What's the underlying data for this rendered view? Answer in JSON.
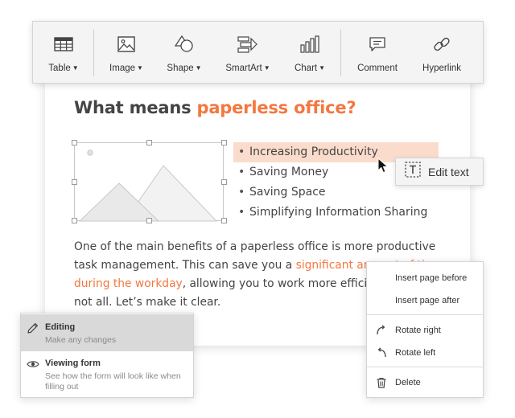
{
  "toolbar": {
    "items": [
      {
        "label": "Table",
        "icon": "table-icon",
        "has_dropdown": true
      },
      {
        "label": "Image",
        "icon": "image-icon",
        "has_dropdown": true
      },
      {
        "label": "Shape",
        "icon": "shape-icon",
        "has_dropdown": true
      },
      {
        "label": "SmartArt",
        "icon": "smartart-icon",
        "has_dropdown": true
      },
      {
        "label": "Chart",
        "icon": "chart-icon",
        "has_dropdown": true
      },
      {
        "label": "Comment",
        "icon": "comment-icon",
        "has_dropdown": false
      },
      {
        "label": "Hyperlink",
        "icon": "hyperlink-icon",
        "has_dropdown": false
      }
    ]
  },
  "document": {
    "title_plain": "What means ",
    "title_accent": "paperless office?",
    "bullets": [
      "Increasing Productivity",
      "Saving Money",
      "Saving Space",
      "Simplifying Information Sharing"
    ],
    "highlighted_bullet": 0,
    "paragraph": {
      "before_link": "One of the main benefits of a paperless office is more productive task management. This can save you a ",
      "link": "significant amount of time during the workday",
      "after_link": ", allowing you to work more efficiently. But it’s not all. Let’s make it clear."
    }
  },
  "edit_tooltip": {
    "label": "Edit text",
    "icon": "text-frame-icon"
  },
  "context_menu": {
    "groups": [
      [
        {
          "label": "Insert page before",
          "icon": ""
        },
        {
          "label": "Insert page after",
          "icon": ""
        }
      ],
      [
        {
          "label": "Rotate right",
          "icon": "rotate-right-icon"
        },
        {
          "label": "Rotate left",
          "icon": "rotate-left-icon"
        }
      ],
      [
        {
          "label": "Delete",
          "icon": "trash-icon"
        }
      ]
    ]
  },
  "mode_menu": {
    "items": [
      {
        "title": "Editing",
        "description": "Make any changes",
        "icon": "pencil-icon",
        "active": true
      },
      {
        "title": "Viewing form",
        "description": "See how the form will look like when filling out",
        "icon": "eye-icon",
        "active": false
      }
    ]
  },
  "colors": {
    "accent": "#f4773f",
    "highlight": "#fbdccc",
    "toolbar_bg": "#f4f4f4",
    "active_item": "#d9d9d9"
  }
}
